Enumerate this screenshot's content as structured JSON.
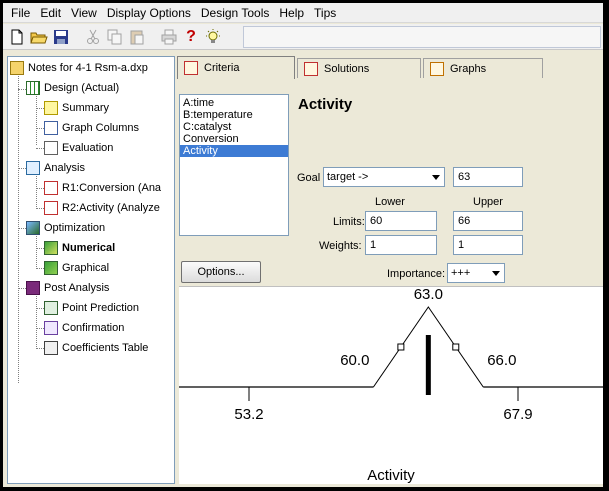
{
  "menu": [
    "File",
    "Edit",
    "View",
    "Display Options",
    "Design Tools",
    "Help",
    "Tips"
  ],
  "toolbar": {
    "icons": [
      "new-file-icon",
      "open-folder-icon",
      "save-icon",
      "cut-icon",
      "copy-icon",
      "paste-icon",
      "print-icon",
      "help-icon",
      "tips-bulb-icon"
    ],
    "help_glyph": "?"
  },
  "tree": {
    "root": "Notes for 4-1 Rsm-a.dxp",
    "design": "Design (Actual)",
    "summary": "Summary",
    "graph_columns": "Graph Columns",
    "evaluation": "Evaluation",
    "analysis": "Analysis",
    "r1": "R1:Conversion (Ana",
    "r2": "R2:Activity (Analyze",
    "optimization": "Optimization",
    "numerical": "Numerical",
    "graphical": "Graphical",
    "post_analysis": "Post Analysis",
    "point_prediction": "Point Prediction",
    "confirmation": "Confirmation",
    "coefficients_table": "Coefficients Table"
  },
  "tabs": {
    "criteria": "Criteria",
    "solutions": "Solutions",
    "graphs": "Graphs"
  },
  "factors": [
    "A:time",
    "B:temperature",
    "C:catalyst",
    "Conversion",
    "Activity"
  ],
  "selected_factor_index": 4,
  "criteria": {
    "title": "Activity",
    "goal_label": "Goal",
    "goal_value": "target ->",
    "target_value": "63",
    "lower_header": "Lower",
    "upper_header": "Upper",
    "limits_label": "Limits:",
    "lower_limit": "60",
    "upper_limit": "66",
    "weights_label": "Weights:",
    "lower_weight": "1",
    "upper_weight": "1",
    "importance_label": "Importance:",
    "importance_value": "+++",
    "options_button": "Options..."
  },
  "ramp": {
    "target_label": "63.0",
    "lower_label": "60.0",
    "upper_label": "66.0",
    "min_label": "53.2",
    "max_label": "67.9",
    "axis_title": "Activity",
    "min": 53.2,
    "max": 67.9,
    "lower": 60.0,
    "target": 63.0,
    "upper": 66.0
  }
}
